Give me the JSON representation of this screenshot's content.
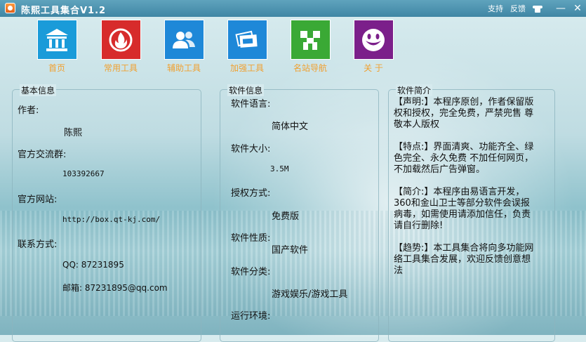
{
  "window": {
    "title": "陈熙工具集合V1.2",
    "support": "支持",
    "feedback": "反馈",
    "minimize": "—",
    "close": "✕"
  },
  "nav": [
    {
      "label": "首页",
      "color": "#1a9bd9",
      "icon": "home-icon"
    },
    {
      "label": "常用工具",
      "color": "#d72b2b",
      "icon": "flame-icon"
    },
    {
      "label": "辅助工具",
      "color": "#1e88d8",
      "icon": "users-icon"
    },
    {
      "label": "加强工具",
      "color": "#1e88d8",
      "icon": "documents-icon"
    },
    {
      "label": "名站导航",
      "color": "#3aa935",
      "icon": "creeper-icon"
    },
    {
      "label": "关 于",
      "color": "#7b1f8a",
      "icon": "smiley-icon"
    }
  ],
  "basic": {
    "title": "基本信息",
    "author_label": "作者:",
    "author": "陈熙",
    "group_label": "官方交流群:",
    "group": "103392667",
    "site_label": "官方网站:",
    "site": "http://box.qt-kj.com/",
    "contact_label": "联系方式:",
    "qq": "QQ: 87231895",
    "email": "邮箱: 87231895@qq.com"
  },
  "software": {
    "title": "软件信息",
    "lang_label": "软件语言:",
    "lang": "简体中文",
    "size_label": "软件大小:",
    "size": "3.5M",
    "license_label": "授权方式:",
    "license": "免费版",
    "nature_label": "软件性质:",
    "nature": "国产软件",
    "category_label": "软件分类:",
    "category": "游戏娱乐/游戏工具",
    "env_label": "运行环境:"
  },
  "intro": {
    "title": "软件简介",
    "p1": "【声明:】本程序原创，作者保留版权和授权，完全免费，严禁兜售 尊敬本人版权",
    "p2": "【特点:】界面清爽、功能齐全、绿色完全、永久免费 不加任何网页，不加载然后广告弹窗。",
    "p3": "【简介:】本程序由易语言开发，360和金山卫士等部分软件会误报病毒，如需使用请添加信任，负责请自行删除!",
    "p4": "【趋势:】本工具集合将向多功能网络工具集合发展，欢迎反馈创意想法"
  }
}
